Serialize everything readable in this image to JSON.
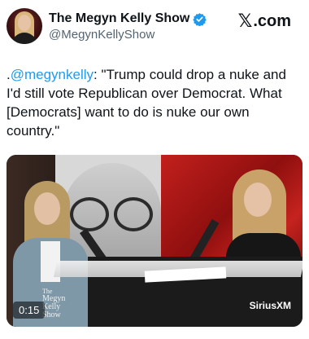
{
  "header": {
    "display_name": "The Megyn Kelly Show",
    "handle": "@MegynKellyShow",
    "brand": ".com",
    "brand_mark": "𝕏",
    "verified_icon": "verified-badge-icon",
    "verified_color": "#1d9bf0"
  },
  "tweet": {
    "prefix": ".",
    "mention": "@megynkelly",
    "body": ": \"Trump could drop a nuke and I'd still vote Republican over Democrat. What [Democrats] want to do is nuke our own country.\""
  },
  "video": {
    "duration": "0:15",
    "show_logo_line1": "The",
    "show_logo_line2": "Megyn",
    "show_logo_line3": "Kelly",
    "show_logo_line4": "Show",
    "network_logo": "SiriusXM"
  },
  "colors": {
    "accent": "#1d9bf0",
    "text": "#0f1419",
    "muted": "#536471"
  }
}
